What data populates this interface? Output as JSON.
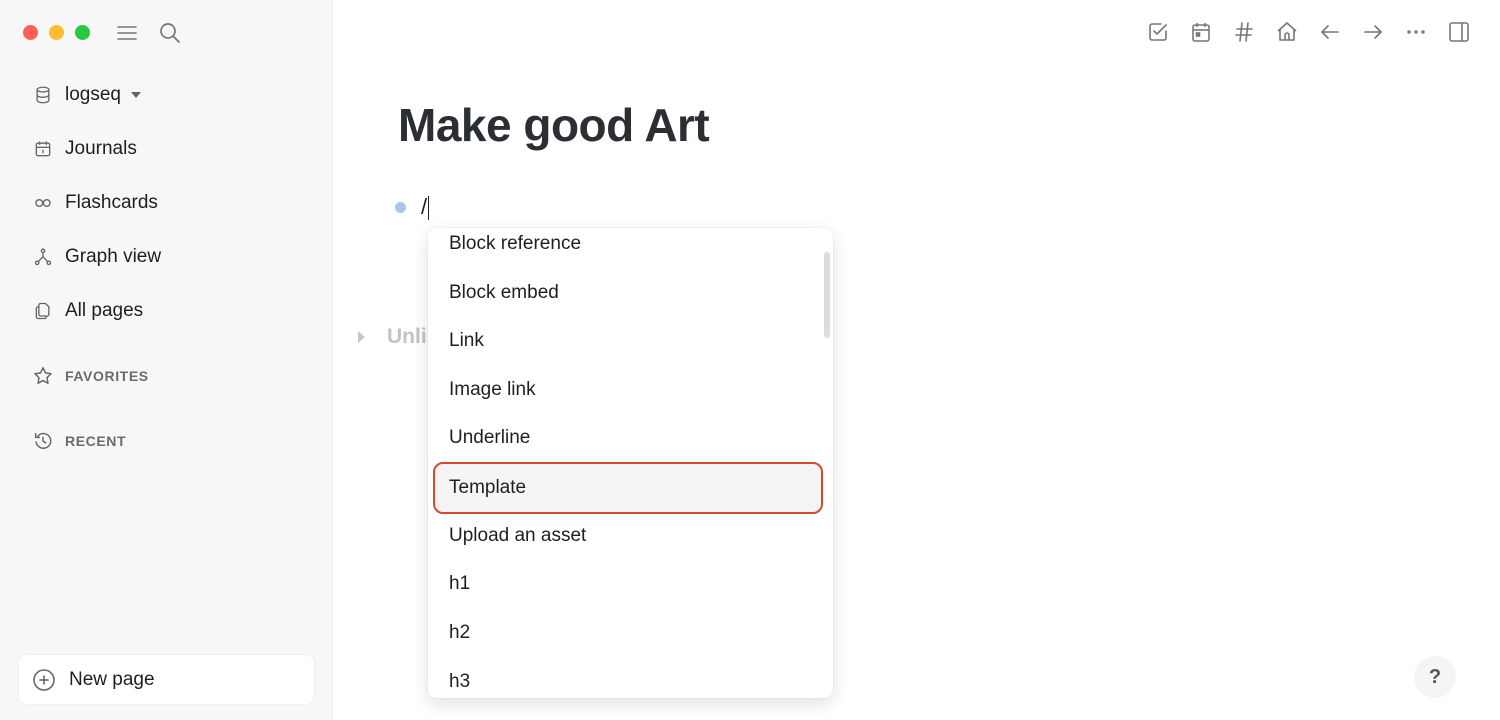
{
  "window": {
    "traffic_lights": [
      "close",
      "minimize",
      "maximize"
    ],
    "colors": {
      "close": "#ff5f57",
      "minimize": "#febc2e",
      "maximize": "#28c840"
    }
  },
  "sidebar": {
    "top_icons": [
      "menu-icon",
      "search-icon"
    ],
    "graph": {
      "label": "logseq",
      "icon": "database-icon"
    },
    "items": [
      {
        "label": "Journals",
        "icon": "calendar-icon"
      },
      {
        "label": "Flashcards",
        "icon": "infinity-icon"
      },
      {
        "label": "Graph view",
        "icon": "graph-icon"
      },
      {
        "label": "All pages",
        "icon": "pages-icon"
      }
    ],
    "sections": [
      {
        "label": "FAVORITES",
        "icon": "star-icon"
      },
      {
        "label": "RECENT",
        "icon": "history-icon"
      }
    ],
    "new_page": {
      "label": "New page",
      "icon": "plus-circle-icon"
    }
  },
  "toolbar": {
    "buttons": [
      "tasks-icon",
      "calendar-icon",
      "hashtag-icon",
      "home-icon",
      "arrow-left-icon",
      "arrow-right-icon",
      "more-icon",
      "sidebar-toggle-icon"
    ]
  },
  "page": {
    "title": "Make good Art",
    "block_text": "/",
    "unlinked_label": "Unli"
  },
  "command_menu": {
    "items": [
      "Block reference",
      "Block embed",
      "Link",
      "Image link",
      "Underline",
      "Template",
      "Upload an asset",
      "h1",
      "h2",
      "h3"
    ],
    "highlighted": "Template",
    "highlight_color": "#d9482b"
  },
  "help": {
    "label": "?"
  }
}
